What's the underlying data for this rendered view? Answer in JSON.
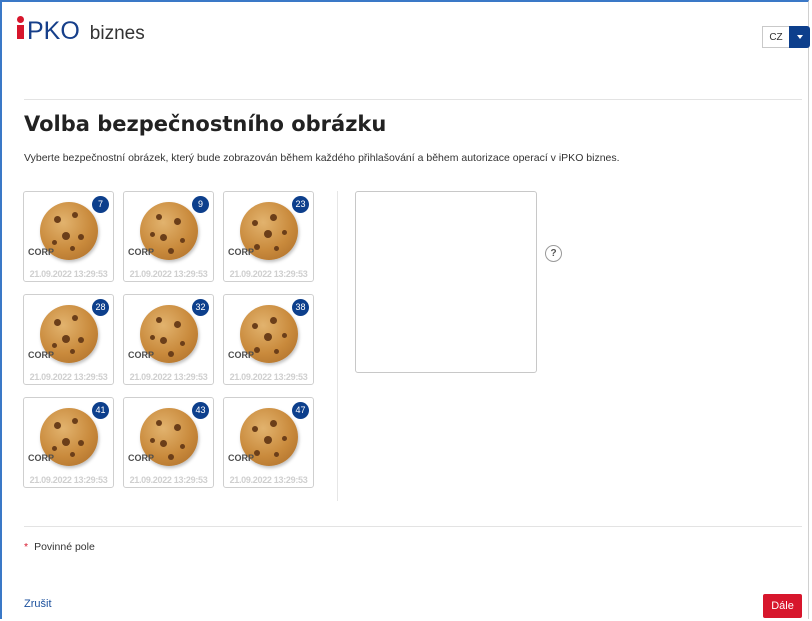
{
  "header": {
    "logo_brand": "PKO",
    "logo_suffix": "biznes",
    "language": "CZ"
  },
  "page": {
    "title": "Volba bezpečnostního obrázku",
    "description": "Vyberte bezpečnostní obrázek, který bude zobrazován během každého přihlašování a během autorizace operací v iPKO biznes."
  },
  "images": [
    {
      "number": "7",
      "label": "CORP",
      "stamp": "21.09.2022 13:29:53"
    },
    {
      "number": "9",
      "label": "CORP",
      "stamp": "21.09.2022 13:29:53"
    },
    {
      "number": "23",
      "label": "CORP",
      "stamp": "21.09.2022 13:29:53"
    },
    {
      "number": "28",
      "label": "CORP",
      "stamp": "21.09.2022 13:29:53"
    },
    {
      "number": "32",
      "label": "CORP",
      "stamp": "21.09.2022 13:29:53"
    },
    {
      "number": "38",
      "label": "CORP",
      "stamp": "21.09.2022 13:29:53"
    },
    {
      "number": "41",
      "label": "CORP",
      "stamp": "21.09.2022 13:29:53"
    },
    {
      "number": "43",
      "label": "CORP",
      "stamp": "21.09.2022 13:29:53"
    },
    {
      "number": "47",
      "label": "CORP",
      "stamp": "21.09.2022 13:29:53"
    }
  ],
  "help_symbol": "?",
  "footer": {
    "required_marker": "*",
    "required_label": "Povinné pole",
    "cancel_label": "Zrušit",
    "next_label": "Dále"
  },
  "colors": {
    "brand_blue": "#0d3f8c",
    "brand_red": "#d7162c",
    "frame_blue": "#3a78c7"
  }
}
